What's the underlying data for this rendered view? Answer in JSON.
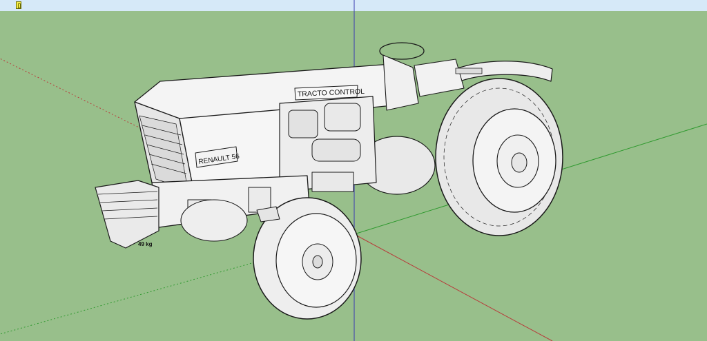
{
  "viewport": {
    "sky_color": "#d6e9f8",
    "ground_color": "#98bf8b",
    "axis_colors": {
      "red": "#b83a3a",
      "green": "#2f9a2f",
      "blue": "#3a3ab0"
    }
  },
  "model": {
    "name_plate": "TRACTO CONTROL",
    "brand_badge": "RENAULT 56",
    "weight_label": "49 kg"
  },
  "icons": {
    "selection": "model-handle-icon"
  }
}
